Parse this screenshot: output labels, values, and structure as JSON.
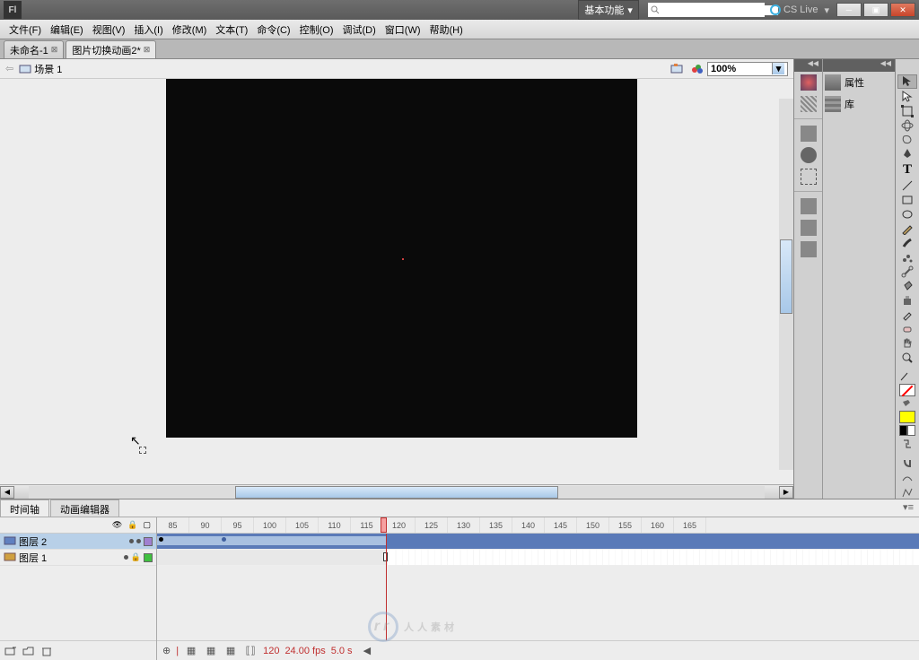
{
  "titlebar": {
    "workspace": "基本功能",
    "cslive": "CS Live"
  },
  "menu": [
    "文件(F)",
    "编辑(E)",
    "视图(V)",
    "插入(I)",
    "修改(M)",
    "文本(T)",
    "命令(C)",
    "控制(O)",
    "调试(D)",
    "窗口(W)",
    "帮助(H)"
  ],
  "tabs": [
    {
      "label": "未命名-1"
    },
    {
      "label": "图片切换动画2*"
    }
  ],
  "active_tab": 1,
  "scene": {
    "label": "场景 1"
  },
  "zoom": "100%",
  "panels": {
    "properties": "属性",
    "library": "库"
  },
  "timeline": {
    "tabs": [
      "时间轴",
      "动画编辑器"
    ],
    "ruler_start": 85,
    "ruler_step": 5,
    "ruler_count": 17,
    "layers": [
      {
        "name": "图层 2",
        "selected": true,
        "color": "purple"
      },
      {
        "name": "图层 1",
        "selected": false,
        "color": "green"
      }
    ],
    "playhead_frame": 120,
    "status": {
      "frame": "120",
      "fps": "24.00 fps",
      "time": "5.0 s"
    }
  },
  "watermark": "人人素材"
}
